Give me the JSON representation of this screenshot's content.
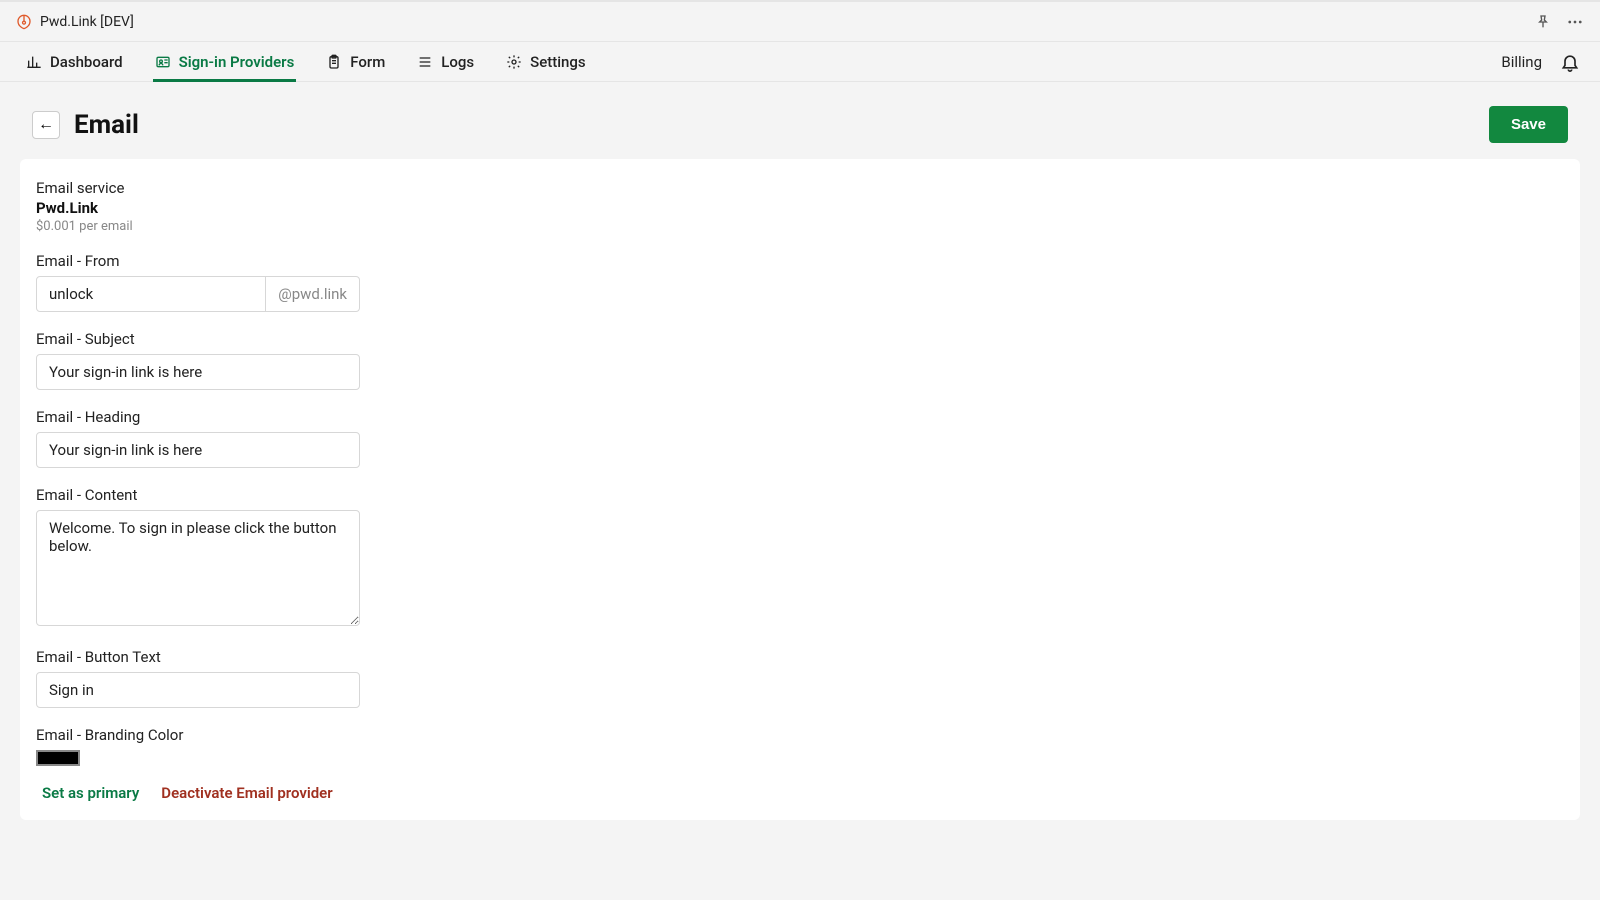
{
  "topstrip": {
    "brand_text": "Pwd.Link  [DEV]"
  },
  "nav": {
    "tabs": [
      {
        "label": "Dashboard"
      },
      {
        "label": "Sign-in Providers"
      },
      {
        "label": "Form"
      },
      {
        "label": "Logs"
      },
      {
        "label": "Settings"
      }
    ],
    "billing_label": "Billing"
  },
  "header": {
    "title": "Email",
    "save_label": "Save"
  },
  "form": {
    "service_label": "Email service",
    "service_name": "Pwd.Link",
    "service_price": "$0.001 per email",
    "from_label": "Email - From",
    "from_value": "unlock",
    "from_suffix": "@pwd.link",
    "subject_label": "Email - Subject",
    "subject_value": "Your sign-in link is here",
    "heading_label": "Email - Heading",
    "heading_value": "Your sign-in link is here",
    "content_label": "Email - Content",
    "content_value": "Welcome. To sign in please click the button below.",
    "button_text_label": "Email - Button Text",
    "button_text_value": "Sign in",
    "branding_color_label": "Email - Branding Color",
    "branding_color_value": "#000000",
    "set_primary_label": "Set as primary",
    "deactivate_label": "Deactivate Email provider"
  }
}
